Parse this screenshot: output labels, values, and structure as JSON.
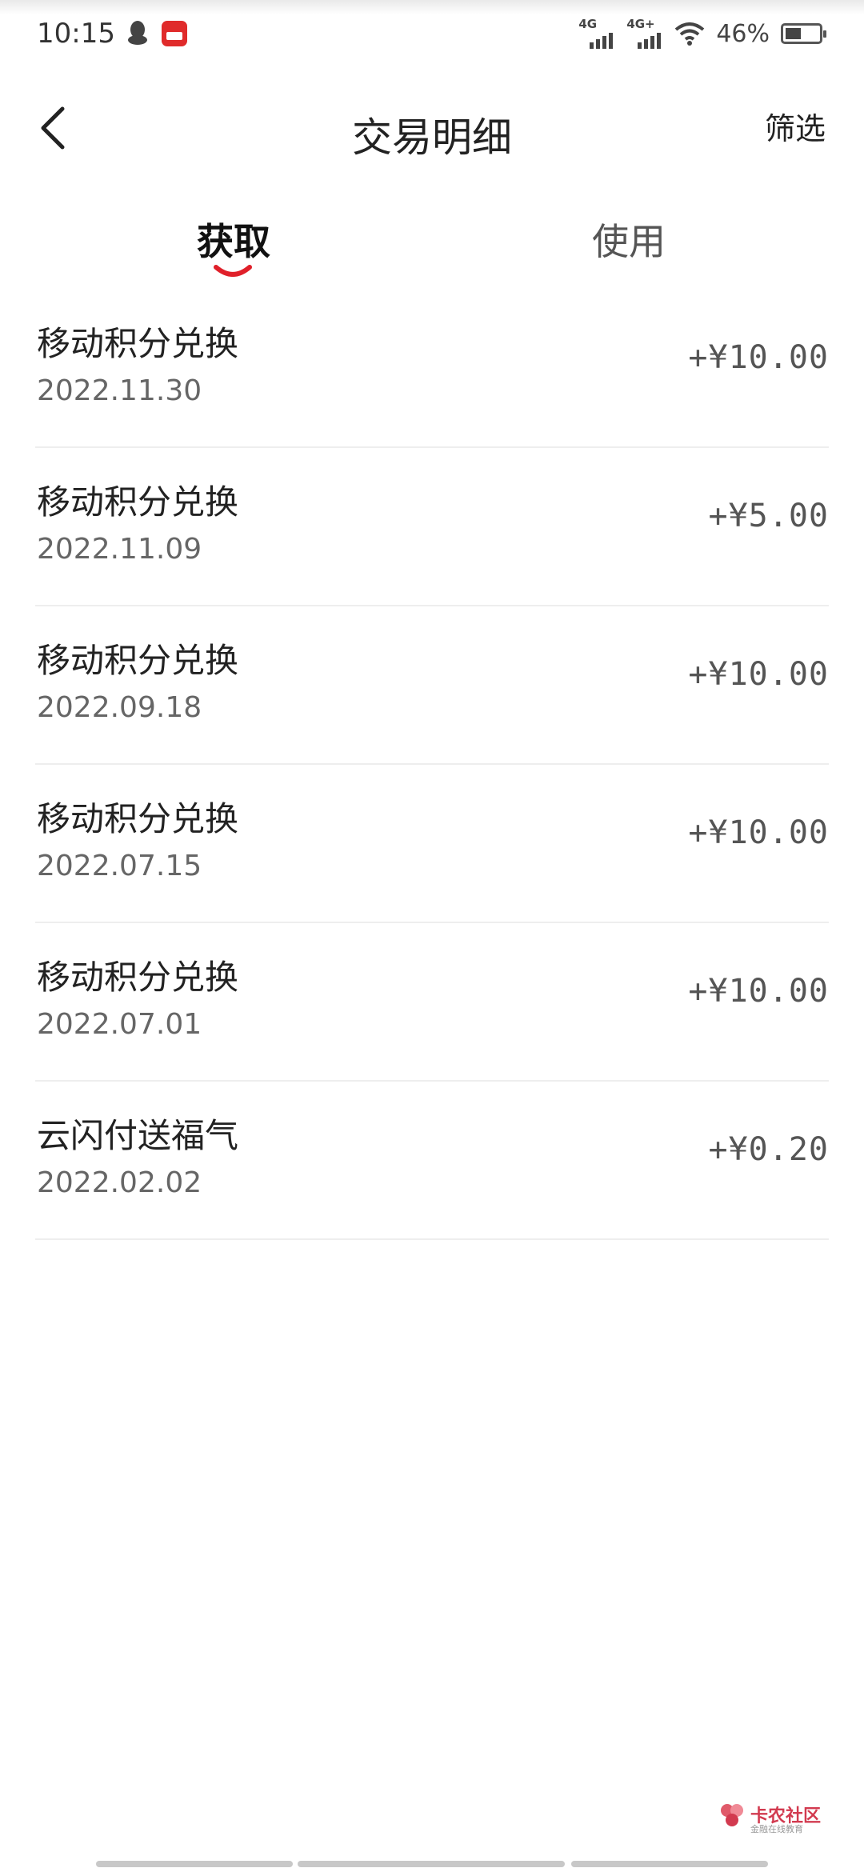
{
  "status_bar": {
    "time": "10:15",
    "signal1_label": "4G",
    "signal2_label": "4G+",
    "battery_percent": "46%",
    "battery_level": 0.46
  },
  "header": {
    "title": "交易明细",
    "filter_label": "筛选"
  },
  "tabs": [
    {
      "label": "获取",
      "active": true
    },
    {
      "label": "使用",
      "active": false
    }
  ],
  "transactions": [
    {
      "title": "移动积分兑换",
      "date": "2022.11.30",
      "amount": "+¥10.00"
    },
    {
      "title": "移动积分兑换",
      "date": "2022.11.09",
      "amount": "+¥5.00"
    },
    {
      "title": "移动积分兑换",
      "date": "2022.09.18",
      "amount": "+¥10.00"
    },
    {
      "title": "移动积分兑换",
      "date": "2022.07.15",
      "amount": "+¥10.00"
    },
    {
      "title": "移动积分兑换",
      "date": "2022.07.01",
      "amount": "+¥10.00"
    },
    {
      "title": "云闪付送福气",
      "date": "2022.02.02",
      "amount": "+¥0.20"
    }
  ],
  "watermark": {
    "text": "卡农社区",
    "subtext": "金融在线教育"
  },
  "colors": {
    "accent": "#e0202a",
    "text_primary": "#222222",
    "text_secondary": "#666666",
    "divider": "#eeeeee"
  }
}
